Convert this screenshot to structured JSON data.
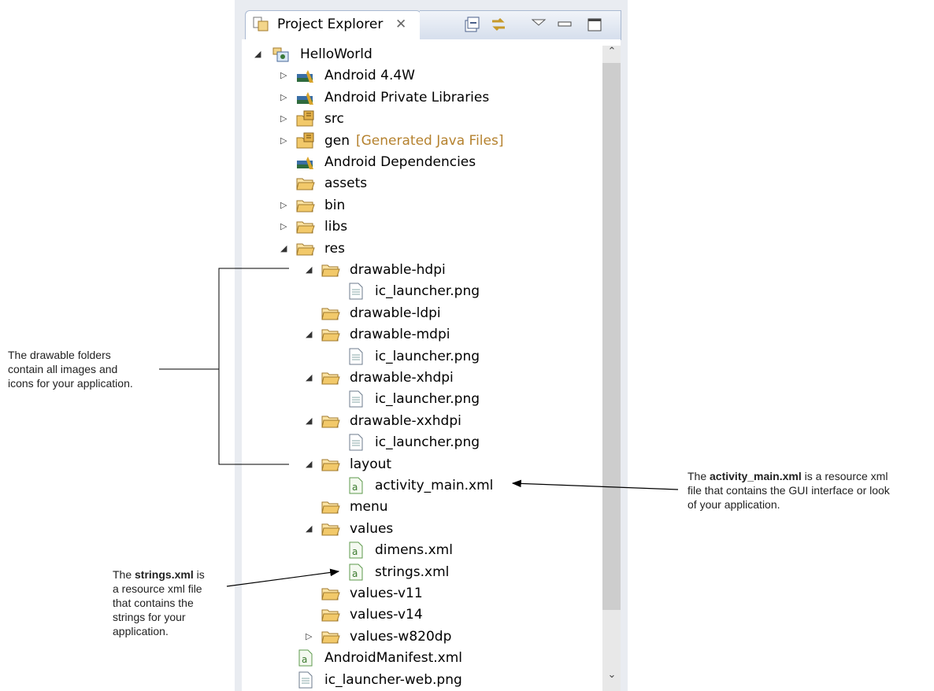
{
  "view": {
    "title": "Project Explorer",
    "close_glyph": "✕",
    "icons": [
      "project-explorer-icon",
      "collapse-all-icon",
      "link-with-editor-icon",
      "view-menu-icon",
      "minimize-icon",
      "maximize-icon"
    ]
  },
  "tree": [
    {
      "label": "HelloWorld",
      "expand": "expanded",
      "icon": "java-project-icon",
      "level": 0
    },
    {
      "label": "Android 4.4W",
      "expand": "collapsed",
      "icon": "library-icon",
      "level": 1
    },
    {
      "label": "Android Private Libraries",
      "expand": "collapsed",
      "icon": "library-icon",
      "level": 1
    },
    {
      "label": "src",
      "expand": "collapsed",
      "icon": "source-folder-icon",
      "level": 1
    },
    {
      "label": "gen",
      "decoration": "[Generated Java Files]",
      "expand": "collapsed",
      "icon": "source-folder-icon",
      "level": 1
    },
    {
      "label": "Android Dependencies",
      "expand": "none",
      "icon": "library-icon",
      "level": 1
    },
    {
      "label": "assets",
      "expand": "none",
      "icon": "folder-icon",
      "level": 1
    },
    {
      "label": "bin",
      "expand": "collapsed",
      "icon": "folder-icon",
      "level": 1
    },
    {
      "label": "libs",
      "expand": "collapsed",
      "icon": "folder-icon",
      "level": 1
    },
    {
      "label": "res",
      "expand": "expanded",
      "icon": "folder-icon",
      "level": 1
    },
    {
      "label": "drawable-hdpi",
      "expand": "expanded",
      "icon": "folder-icon",
      "level": 2
    },
    {
      "label": "ic_launcher.png",
      "expand": "none",
      "icon": "file-icon",
      "level": 3
    },
    {
      "label": "drawable-ldpi",
      "expand": "none",
      "icon": "folder-icon",
      "level": 2
    },
    {
      "label": "drawable-mdpi",
      "expand": "expanded",
      "icon": "folder-icon",
      "level": 2
    },
    {
      "label": "ic_launcher.png",
      "expand": "none",
      "icon": "file-icon",
      "level": 3
    },
    {
      "label": "drawable-xhdpi",
      "expand": "expanded",
      "icon": "folder-icon",
      "level": 2
    },
    {
      "label": "ic_launcher.png",
      "expand": "none",
      "icon": "file-icon",
      "level": 3
    },
    {
      "label": "drawable-xxhdpi",
      "expand": "expanded",
      "icon": "folder-icon",
      "level": 2
    },
    {
      "label": "ic_launcher.png",
      "expand": "none",
      "icon": "file-icon",
      "level": 3
    },
    {
      "label": "layout",
      "expand": "expanded",
      "icon": "folder-icon",
      "level": 2
    },
    {
      "label": "activity_main.xml",
      "expand": "none",
      "icon": "xml-file-icon",
      "level": 3
    },
    {
      "label": "menu",
      "expand": "none",
      "icon": "folder-icon",
      "level": 2
    },
    {
      "label": "values",
      "expand": "expanded",
      "icon": "folder-icon",
      "level": 2
    },
    {
      "label": "dimens.xml",
      "expand": "none",
      "icon": "xml-file-icon",
      "level": 3
    },
    {
      "label": "strings.xml",
      "expand": "none",
      "icon": "xml-file-icon",
      "level": 3
    },
    {
      "label": "values-v11",
      "expand": "none",
      "icon": "folder-icon",
      "level": 2
    },
    {
      "label": "values-v14",
      "expand": "none",
      "icon": "folder-icon",
      "level": 2
    },
    {
      "label": "values-w820dp",
      "expand": "collapsed",
      "icon": "folder-icon",
      "level": 2
    },
    {
      "label": "AndroidManifest.xml",
      "expand": "none",
      "icon": "xml-file-icon",
      "level": 1
    },
    {
      "label": "ic_launcher-web.png",
      "expand": "none",
      "icon": "file-icon",
      "level": 1
    }
  ],
  "annotations": {
    "drawable": {
      "line1": "The drawable folders",
      "line2": "contain all images and",
      "line3": "icons for your application."
    },
    "activity": {
      "pre": "The ",
      "bold": "activity_main.xml",
      "post": " is a resource xml",
      "line2": "file that contains the GUI interface or look",
      "line3": "of your application."
    },
    "strings": {
      "pre": "The ",
      "bold": "strings.xml",
      "post": " is",
      "line2": "a resource xml file",
      "line3": "that contains the",
      "line4": "strings for your",
      "line5": "application."
    }
  },
  "colors": {
    "folder": "#f2c96a",
    "library": "#3a6ea5",
    "xml": "#5e9a4d",
    "decoration": "#b5822f"
  }
}
